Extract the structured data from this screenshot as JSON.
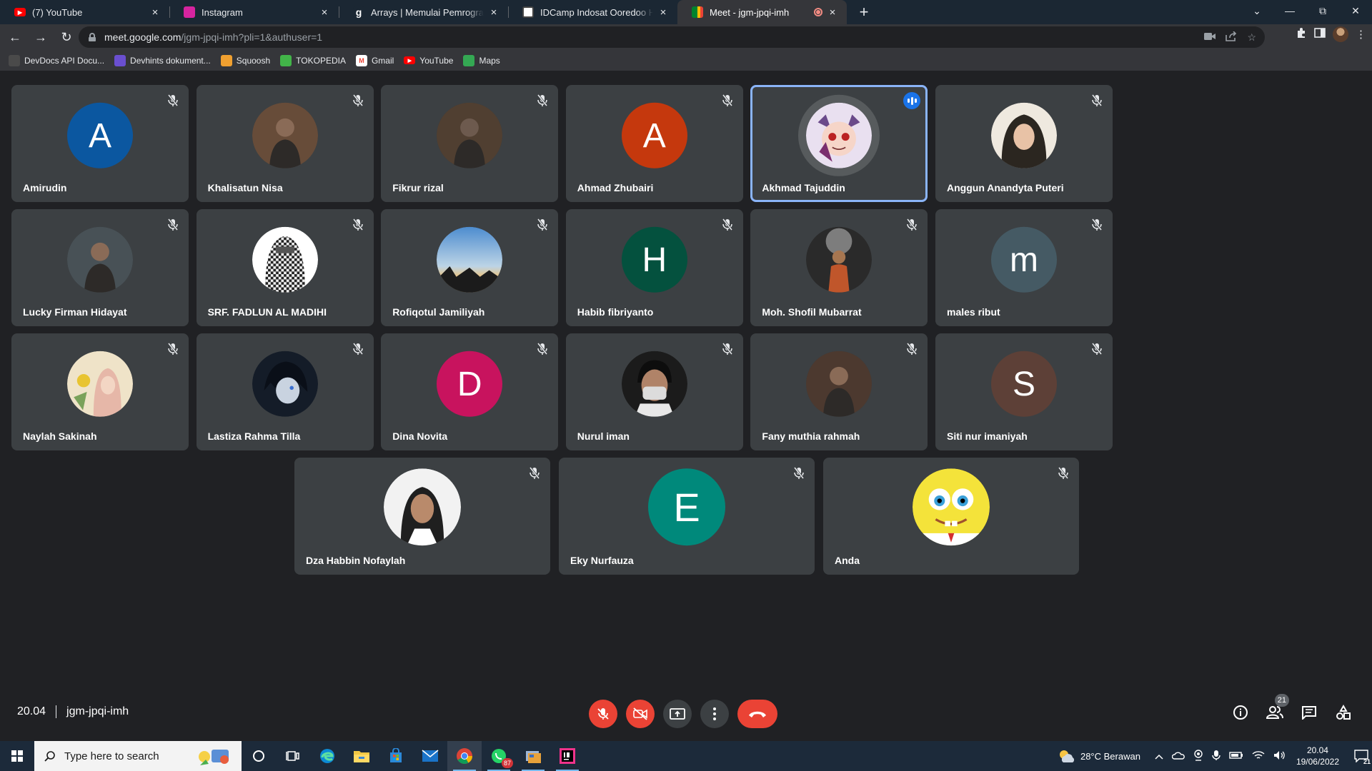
{
  "browser": {
    "tabs": [
      {
        "title": "(7) YouTube",
        "favicon": "youtube-icon",
        "color": "#ff0000"
      },
      {
        "title": "Instagram",
        "favicon": "instagram-icon",
        "color": "#d6249f"
      },
      {
        "title": "Arrays | Memulai Pemrograman D",
        "favicon": "codepolitan-icon",
        "color": "#1b2733"
      },
      {
        "title": "IDCamp Indosat Ooredoo Hutchi",
        "favicon": "idcamp-icon",
        "color": "#ffffff"
      },
      {
        "title": "Meet - jgm-jpqi-imh",
        "favicon": "meet-icon",
        "color": "#00832d"
      }
    ],
    "url_host": "meet.google.com",
    "url_path": "/jgm-jpqi-imh?pli=1&authuser=1",
    "bookmarks": [
      {
        "label": "DevDocs API Docu...",
        "icon": "devdocs-icon",
        "color": "#4a4a4a"
      },
      {
        "label": "Devhints dokument...",
        "icon": "devhints-icon",
        "color": "#6a4fd0"
      },
      {
        "label": "Squoosh",
        "icon": "squoosh-icon",
        "color": "#f0a030"
      },
      {
        "label": "TOKOPEDIA",
        "icon": "tokopedia-icon",
        "color": "#42b549"
      },
      {
        "label": "Gmail",
        "icon": "gmail-icon",
        "color": "#ea4335"
      },
      {
        "label": "YouTube",
        "icon": "youtube-icon",
        "color": "#ff0000"
      },
      {
        "label": "Maps",
        "icon": "maps-icon",
        "color": "#34a853"
      }
    ]
  },
  "meet": {
    "participants": [
      {
        "name": "Amirudin",
        "avatar_type": "letter",
        "letter": "A",
        "color": "#0b57a0",
        "muted": true
      },
      {
        "name": "Khalisatun Nisa",
        "avatar_type": "photo",
        "color": "#7a5a44",
        "muted": true
      },
      {
        "name": "Fikrur rizal",
        "avatar_type": "photo",
        "color": "#5e4a3a",
        "muted": true
      },
      {
        "name": "Ahmad Zhubairi",
        "avatar_type": "letter",
        "letter": "A",
        "color": "#c5380d",
        "muted": true
      },
      {
        "name": "Akhmad Tajuddin",
        "avatar_type": "photo",
        "color": "#d9cfe6",
        "muted": false,
        "speaking": true
      },
      {
        "name": "Anggun Anandyta Puteri",
        "avatar_type": "photo",
        "color": "#2b2620",
        "muted": true
      },
      {
        "name": "Lucky Firman Hidayat",
        "avatar_type": "photo",
        "color": "#556066",
        "muted": true
      },
      {
        "name": "SRF. FADLUN AL MADIHI",
        "avatar_type": "photo",
        "color": "#6e6e6e",
        "muted": true
      },
      {
        "name": "Rofiqotul Jamiliyah",
        "avatar_type": "photo",
        "color": "#87b2d6",
        "muted": true
      },
      {
        "name": "Habib fibriyanto",
        "avatar_type": "letter",
        "letter": "H",
        "color": "#04513e",
        "muted": true
      },
      {
        "name": "Moh. Shofil Mubarrat",
        "avatar_type": "photo",
        "color": "#4a4a4a",
        "muted": true
      },
      {
        "name": "males ribut",
        "avatar_type": "letter",
        "letter": "m",
        "color": "#455a64",
        "muted": true
      },
      {
        "name": "Naylah Sakinah",
        "avatar_type": "photo",
        "color": "#e9c9a3",
        "muted": true
      },
      {
        "name": "Lastiza Rahma Tilla",
        "avatar_type": "photo",
        "color": "#1e2a3a",
        "muted": true
      },
      {
        "name": "Dina Novita",
        "avatar_type": "letter",
        "letter": "D",
        "color": "#c8135e",
        "muted": true
      },
      {
        "name": "Nurul iman",
        "avatar_type": "photo",
        "color": "#2b2b2b",
        "muted": true
      },
      {
        "name": "Fany muthia rahmah",
        "avatar_type": "photo",
        "color": "#5a4438",
        "muted": true
      },
      {
        "name": "Siti nur imaniyah",
        "avatar_type": "letter",
        "letter": "S",
        "color": "#5d4037",
        "muted": true
      },
      {
        "name": "Dza Habbin Nofaylah",
        "avatar_type": "photo",
        "color": "#f0f0f0",
        "muted": true
      },
      {
        "name": "Eky Nurfauza",
        "avatar_type": "letter",
        "letter": "E",
        "color": "#00897b",
        "muted": true
      },
      {
        "name": "Anda",
        "avatar_type": "photo",
        "color": "#f4e33a",
        "muted": true
      }
    ],
    "time": "20.04",
    "meeting_code": "jgm-jpqi-imh",
    "participant_count": "21"
  },
  "taskbar": {
    "search_placeholder": "Type here to search",
    "weather": "28°C  Berawan",
    "clock_time": "20.04",
    "clock_date": "19/06/2022",
    "notification_count": "21",
    "whatsapp_badge": "87"
  }
}
